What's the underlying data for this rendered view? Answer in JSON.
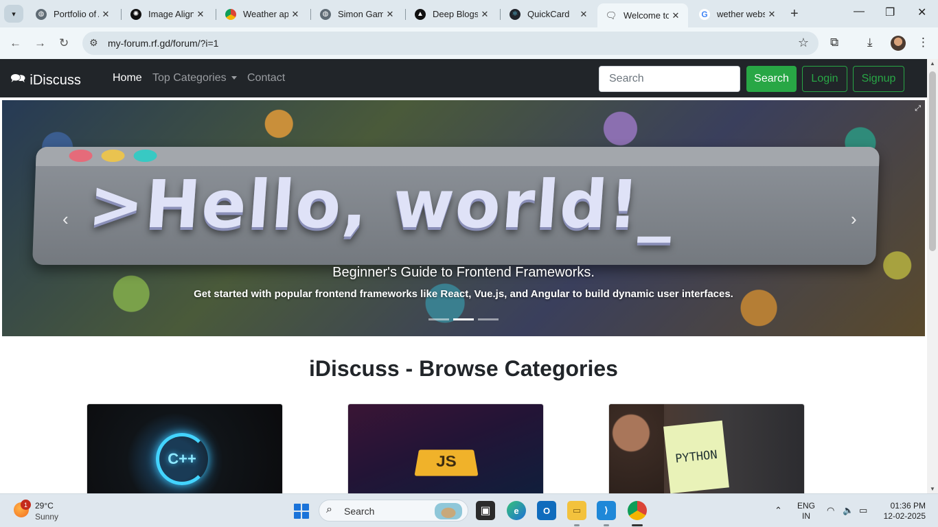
{
  "browser": {
    "tabs": [
      {
        "title": "Portfolio of A",
        "favicon": "globe-icon"
      },
      {
        "title": "Image Alignm",
        "favicon": "openai-icon"
      },
      {
        "title": "Weather app",
        "favicon": "chrome-icon"
      },
      {
        "title": "Simon Game",
        "favicon": "globe-icon"
      },
      {
        "title": "Deep Blogs",
        "favicon": "triangle-icon"
      },
      {
        "title": "QuickCard",
        "favicon": "react-icon"
      },
      {
        "title": "Welcome to",
        "favicon": "chat-icon"
      },
      {
        "title": "wether webs",
        "favicon": "google-icon"
      }
    ],
    "active_tab": 6,
    "url": "my-forum.rf.gd/forum/?i=1"
  },
  "navbar": {
    "brand": "iDiscuss",
    "links": [
      "Home",
      "Top Categories",
      "Contact"
    ],
    "search_placeholder": "Search",
    "search_button": "Search",
    "login": "Login",
    "signup": "Signup"
  },
  "carousel": {
    "banner_text": ">Hello, world!_",
    "title": "Beginner's Guide to Frontend Frameworks.",
    "text": "Get started with popular frontend frameworks like React, Vue.js, and Angular to build dynamic user interfaces.",
    "slide_count": 3,
    "active_slide": 2
  },
  "categories": {
    "heading": "iDiscuss - Browse Categories",
    "cards": [
      {
        "name": "C++",
        "logo_text": "C++"
      },
      {
        "name": "JavaScript",
        "logo_text": "JS"
      },
      {
        "name": "Python",
        "logo_text": "PYTHON"
      }
    ]
  },
  "taskbar": {
    "weather_temp": "29°C",
    "weather_cond": "Sunny",
    "weather_badge": "1",
    "search_label": "Search",
    "lang_1": "ENG",
    "lang_2": "IN",
    "time": "01:36 PM",
    "date": "12-02-2025"
  },
  "colors": {
    "navbar_bg": "#212529",
    "success": "#28a745",
    "tabbar_bg": "#dfe8ee"
  }
}
